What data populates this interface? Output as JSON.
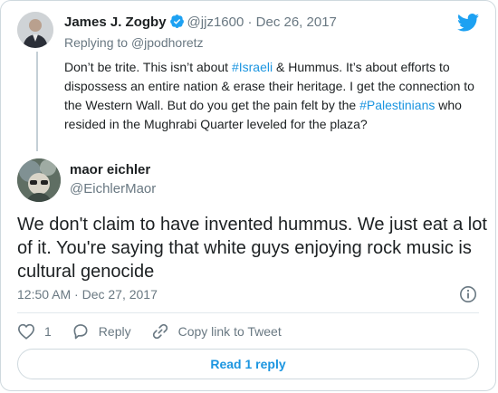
{
  "tweet1": {
    "author_name": "James J. Zogby",
    "handle": "@jjz1600",
    "separator": "·",
    "date": "Dec 26, 2017",
    "replying_to_prefix": "Replying to ",
    "replying_to_handle": "@jpodhoretz",
    "text_part1": "Don’t be trite. This isn’t  about ",
    "hashtag1": "#Israeli",
    "text_part2": " & Hummus. It’s about efforts to dispossess an entire nation & erase their heritage. I get the connection to the Western Wall. But do you get the pain felt by the ",
    "hashtag2": "#Palestinians",
    "text_part3": " who resided in the Mughrabi Quarter leveled for the plaza?"
  },
  "tweet2": {
    "author_name": "maor eichler",
    "handle": "@EichlerMaor",
    "text": "We don't claim to have invented hummus. We just eat a lot of it. You're saying that white guys enjoying rock music is cultural genocide",
    "timestamp": "12:50 AM · Dec 27, 2017"
  },
  "actions": {
    "like_count": "1",
    "reply_label": "Reply",
    "copy_link_label": "Copy link to Tweet"
  },
  "read_reply_label": "Read 1 reply",
  "icons": {
    "logo": "twitter-bird-icon",
    "verified": "verified-badge-icon",
    "info": "info-icon",
    "like": "heart-icon",
    "reply": "reply-bubble-icon",
    "copy_link": "link-icon"
  },
  "colors": {
    "accent": "#1b95e0",
    "muted": "#697882",
    "text": "#1c2022",
    "border": "#cfd9de"
  }
}
